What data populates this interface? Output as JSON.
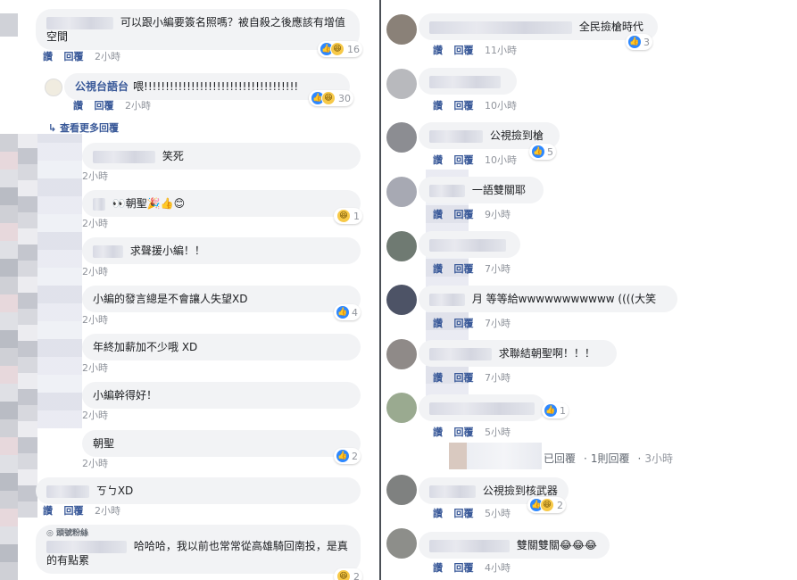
{
  "actions": {
    "like": "讚",
    "reply": "回覆"
  },
  "left_comments": [
    {
      "text": "可以跟小編要簽名照嗎？被自殺之後應該有增值空間",
      "time": "2小時",
      "reactions": "16"
    },
    {
      "author": "公視台語台",
      "text": "喂!!!!!!!!!!!!!!!!!!!!!!!!!!!!!!!!!!!!",
      "time": "2小時",
      "reactions": "30"
    },
    {
      "text": "笑死",
      "time": "2小時"
    },
    {
      "text": "👀朝聖🎉👍😊",
      "time": "2小時",
      "reactions": "1"
    },
    {
      "text": "求聲援小編！！",
      "time": "2小時"
    },
    {
      "text": "小編的發言總是不會讓人失望XD",
      "time": "2小時",
      "reactions": "4"
    },
    {
      "text": "年終加薪加不少哦 XD",
      "time": "2小時"
    },
    {
      "text": "小編幹得好！",
      "time": "2小時"
    },
    {
      "text": "朝聖",
      "time": "2小時",
      "reactions": "2"
    },
    {
      "text": "ㄎㄅXD",
      "time": "2小時"
    },
    {
      "header": "頭號粉絲",
      "text": "哈哈哈，我以前也常常從高雄騎回南投，是真的有點累",
      "reactions": "2"
    }
  ],
  "view_more": "查看更多回覆",
  "right_comments": [
    {
      "text": "全民撿槍時代",
      "time": "11小時",
      "reactions": "3"
    },
    {
      "text": "",
      "time": "10小時"
    },
    {
      "text": "公視撿到槍",
      "time": "10小時",
      "reactions": "5"
    },
    {
      "text": "一語雙關耶",
      "time": "9小時"
    },
    {
      "text": "",
      "time": "7小時"
    },
    {
      "text": "月 等等給wwwwwwwwwww ((((大笑",
      "time": "7小時"
    },
    {
      "text": "求聯結朝聖啊！！！",
      "time": "7小時"
    },
    {
      "text": "",
      "time": "5小時",
      "reactions": "1"
    },
    {
      "text": "公視撿到核武器",
      "time": "5小時",
      "reactions": "2"
    },
    {
      "text": "雙關雙關😂😂😂",
      "time": "4小時"
    }
  ],
  "replied_note": {
    "replied": "已回覆",
    "count": "1則回覆",
    "time": "3小時"
  }
}
